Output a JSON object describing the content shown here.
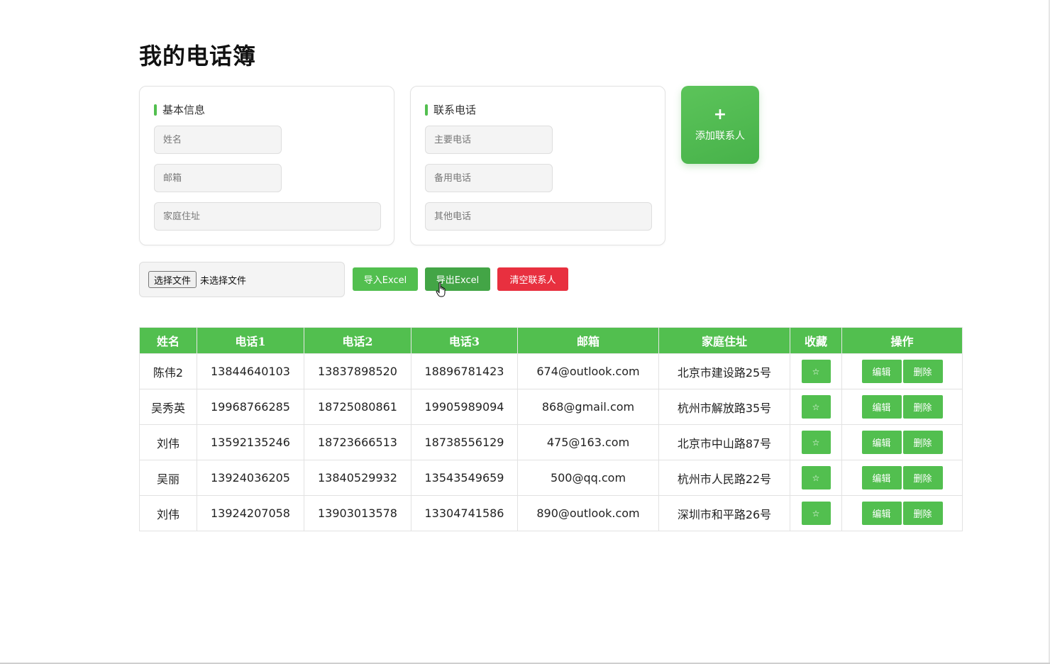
{
  "page": {
    "title": "我的电话簿"
  },
  "basic_info": {
    "heading": "基本信息",
    "name_placeholder": "姓名",
    "email_placeholder": "邮箱",
    "address_placeholder": "家庭住址"
  },
  "phone_info": {
    "heading": "联系电话",
    "primary_placeholder": "主要电话",
    "backup_placeholder": "备用电话",
    "other_placeholder": "其他电话"
  },
  "add_contact": {
    "icon": "+",
    "label": "添加联系人"
  },
  "actions": {
    "file_button_label": "选择文件",
    "file_status": "未选择文件",
    "import_label": "导入Excel",
    "export_label": "导出Excel",
    "clear_label": "清空联系人"
  },
  "colors": {
    "accent": "#52bf4f",
    "accent_hover": "#43a546",
    "danger": "#e8303f"
  },
  "table": {
    "headers": [
      "姓名",
      "电话1",
      "电话2",
      "电话3",
      "邮箱",
      "家庭住址",
      "收藏",
      "操作"
    ],
    "star_icon": "☆",
    "edit_label": "编辑",
    "delete_label": "删除",
    "rows": [
      {
        "name": "陈伟2",
        "phone1": "13844640103",
        "phone2": "13837898520",
        "phone3": "18896781423",
        "email": "674@outlook.com",
        "address": "北京市建设路25号"
      },
      {
        "name": "吴秀英",
        "phone1": "19968766285",
        "phone2": "18725080861",
        "phone3": "19905989094",
        "email": "868@gmail.com",
        "address": "杭州市解放路35号"
      },
      {
        "name": "刘伟",
        "phone1": "13592135246",
        "phone2": "18723666513",
        "phone3": "18738556129",
        "email": "475@163.com",
        "address": "北京市中山路87号"
      },
      {
        "name": "吴丽",
        "phone1": "13924036205",
        "phone2": "13840529932",
        "phone3": "13543549659",
        "email": "500@qq.com",
        "address": "杭州市人民路22号"
      },
      {
        "name": "刘伟",
        "phone1": "13924207058",
        "phone2": "13903013578",
        "phone3": "13304741586",
        "email": "890@outlook.com",
        "address": "深圳市和平路26号"
      }
    ]
  }
}
